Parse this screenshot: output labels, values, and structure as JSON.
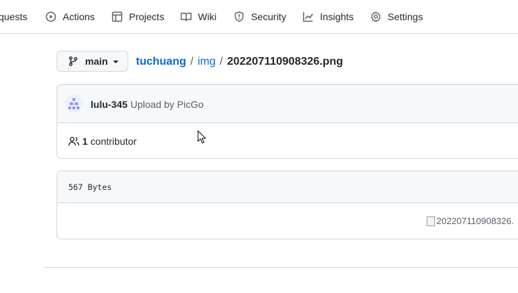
{
  "nav": {
    "items": [
      {
        "label": "quests",
        "icon": "pull-request-icon"
      },
      {
        "label": "Actions",
        "icon": "play-icon"
      },
      {
        "label": "Projects",
        "icon": "table-icon"
      },
      {
        "label": "Wiki",
        "icon": "book-icon"
      },
      {
        "label": "Security",
        "icon": "shield-icon"
      },
      {
        "label": "Insights",
        "icon": "graph-icon"
      },
      {
        "label": "Settings",
        "icon": "gear-icon"
      }
    ]
  },
  "branch": {
    "name": "main",
    "icon": "git-branch-icon"
  },
  "breadcrumb": {
    "repo": "tuchuang",
    "dir": "img",
    "separator": "/",
    "file": "202207110908326.png"
  },
  "commit": {
    "author": "lulu-345",
    "message": "Upload by PicGo"
  },
  "contributors": {
    "count": "1",
    "label": "contributor"
  },
  "file": {
    "size": "567 Bytes",
    "image_alt": "202207110908326."
  },
  "colors": {
    "link": "#0969da",
    "border": "#d0d7de",
    "header_bg": "#f6f8fa",
    "muted": "#57606a"
  }
}
